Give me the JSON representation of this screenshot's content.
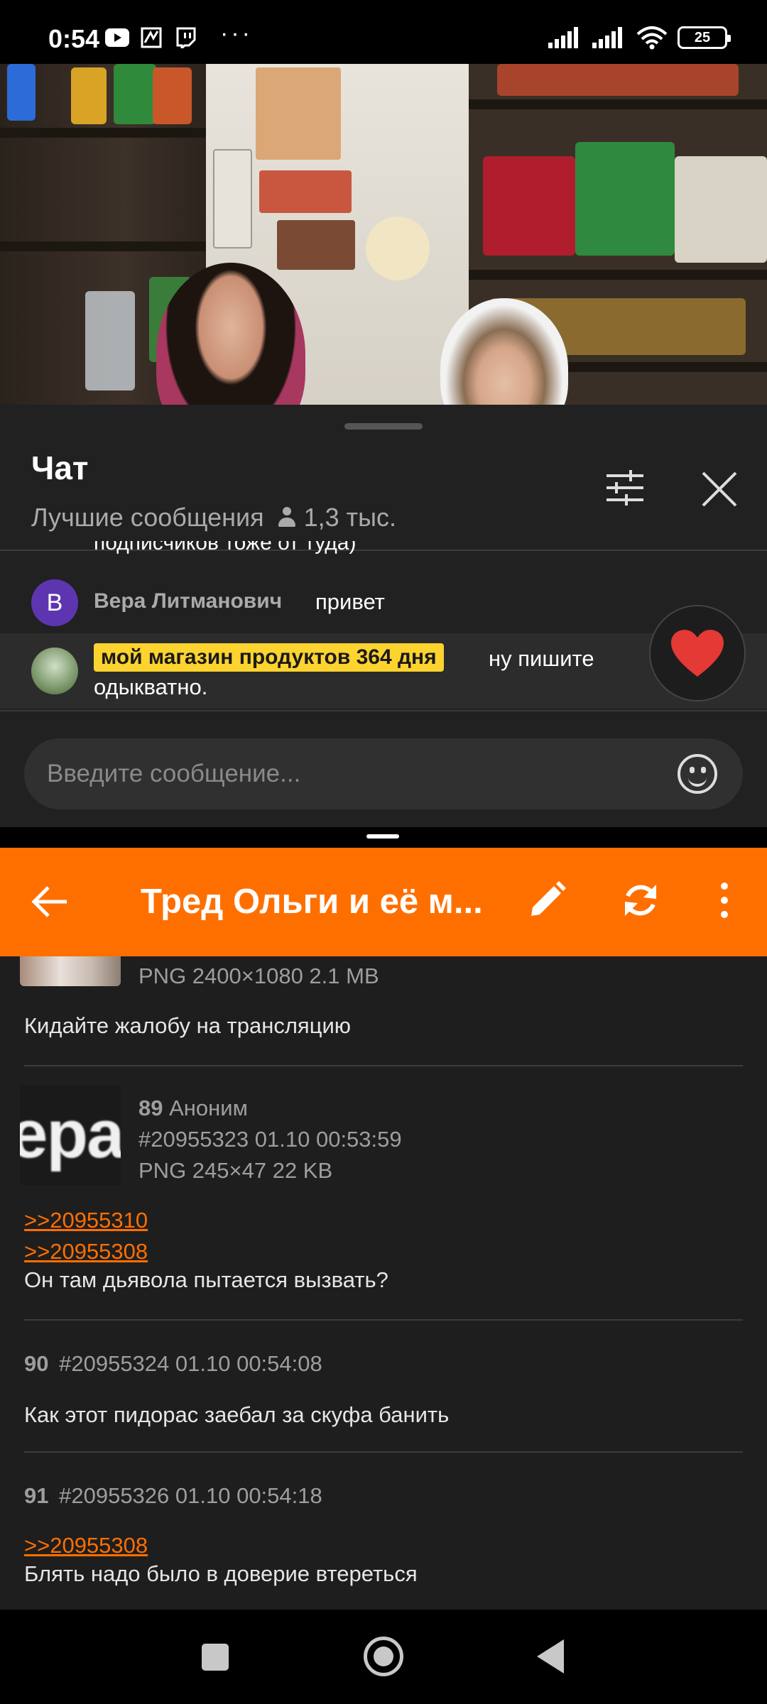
{
  "status_bar": {
    "time": "0:54",
    "battery": "25",
    "dots": "···"
  },
  "chat": {
    "title": "Чат",
    "mode": "Лучшие сообщения",
    "viewers": "1,3 тыс.",
    "cut_message": "подписчиков тоже от туда)",
    "messages": [
      {
        "avatar_letter": "В",
        "author": "Вера Литманович",
        "text": "привет"
      }
    ],
    "highlighted": {
      "badge": "мой магазин продуктов 364 дня",
      "text_line1": "ну пишите",
      "text_line2": "одыкватно."
    },
    "input_placeholder": "Введите сообщение...",
    "accent_color": "#fdd32f"
  },
  "appbar": {
    "title": "Тред Ольги и её м...",
    "color": "#ff6f00"
  },
  "thread": {
    "post88": {
      "file_info": "PNG 2400×1080 2.1 MB",
      "text": "Кидайте жалобу на трансляцию"
    },
    "post89": {
      "num": "89",
      "author": "Аноним",
      "id_date": "#20955323 01.10 00:53:59",
      "file_info": "PNG 245×47 22 KB",
      "thumb_text": "epa",
      "links": [
        ">>20955310",
        ">>20955308"
      ],
      "text": "Он там дьявола пытается вызвать?"
    },
    "post90": {
      "num": "90",
      "id_date": "#20955324 01.10 00:54:08",
      "text": "Как этот пидорас заебал за скуфа банить"
    },
    "post91": {
      "num": "91",
      "id_date": "#20955326 01.10 00:54:18",
      "links": [
        ">>20955308"
      ],
      "text": "Блять надо было в доверие втереться"
    }
  }
}
